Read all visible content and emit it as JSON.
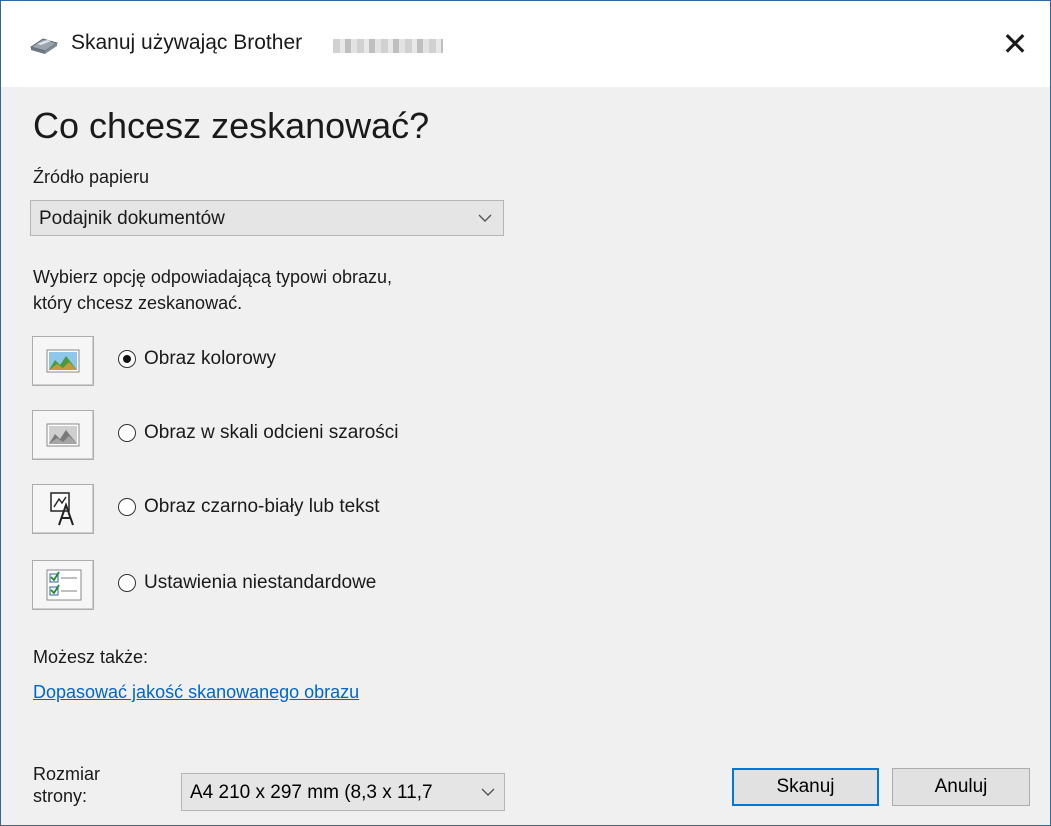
{
  "window": {
    "title": "Skanuj używając Brother",
    "close_glyph": "✕"
  },
  "main": {
    "heading": "Co chcesz zeskanować?",
    "paper_source_label": "Źródło papieru",
    "paper_source_value": "Podajnik dokumentów",
    "instruction_line1": "Wybierz opcję odpowiadającą typowi obrazu,",
    "instruction_line2": "który chcesz zeskanować.",
    "options": [
      {
        "label": "Obraz kolorowy",
        "selected": true,
        "icon": "color-picture-icon"
      },
      {
        "label": "Obraz w skali odcieni szarości",
        "selected": false,
        "icon": "grayscale-picture-icon"
      },
      {
        "label": "Obraz czarno-biały lub tekst",
        "selected": false,
        "icon": "bw-text-icon"
      },
      {
        "label": "Ustawienia niestandardowe",
        "selected": false,
        "icon": "custom-settings-icon"
      }
    ],
    "also_label": "Możesz także:",
    "adjust_link": "Dopasować jakość skanowanego obrazu"
  },
  "footer": {
    "page_size_label_line1": "Rozmiar",
    "page_size_label_line2": "strony:",
    "page_size_value": "A4 210 x 297 mm (8,3 x 11,7",
    "scan_button": "Skanuj",
    "cancel_button": "Anuluj"
  },
  "colors": {
    "accent": "#0078d7",
    "link": "#0066cc"
  }
}
